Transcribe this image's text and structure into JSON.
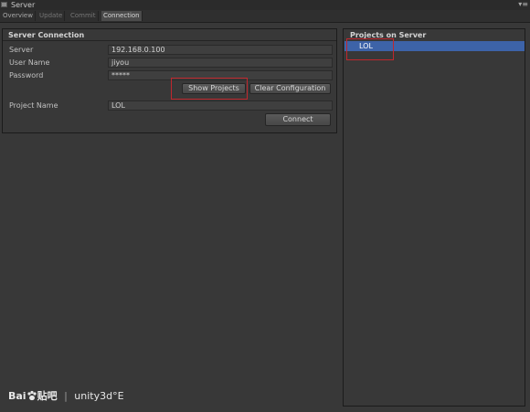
{
  "window": {
    "title": "Server",
    "menu_glyph": "▾≡"
  },
  "tabs": [
    {
      "label": "Overview",
      "state": "normal"
    },
    {
      "label": "Update",
      "state": "disabled"
    },
    {
      "label": "Commit",
      "state": "disabled"
    },
    {
      "label": "Connection",
      "state": "active"
    }
  ],
  "server_connection": {
    "title": "Server Connection",
    "server_label": "Server",
    "server_value": "192.168.0.100",
    "username_label": "User Name",
    "username_value": "jiyou",
    "password_label": "Password",
    "password_value": "*****",
    "show_projects_label": "Show Projects",
    "clear_config_label": "Clear Configuration",
    "project_name_label": "Project Name",
    "project_name_value": "LOL",
    "connect_label": "Connect"
  },
  "projects_on_server": {
    "title": "Projects on Server",
    "items": [
      "LOL"
    ]
  },
  "watermark": {
    "logo_left": "Bai",
    "logo_right": "贴吧",
    "separator": "|",
    "text": "unity3d°E"
  },
  "colors": {
    "background": "#383838",
    "selection": "#3d63a8",
    "highlight_box": "#c0272d"
  }
}
